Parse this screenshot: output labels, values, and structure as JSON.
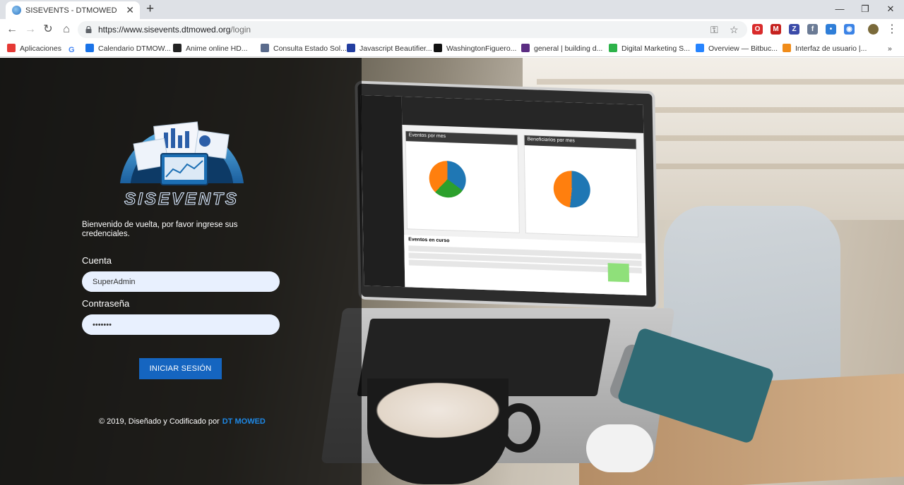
{
  "browser": {
    "tab": {
      "title": "SISEVENTS - DTMOWED",
      "close_glyph": "✕",
      "favicon": "globe-icon"
    },
    "new_tab_glyph": "+",
    "window_controls": {
      "minimize": "—",
      "restore": "❐",
      "close": "✕"
    },
    "nav": {
      "back": "←",
      "forward": "→",
      "reload": "↻",
      "home": "⌂"
    },
    "url": {
      "host": "https://www.sisevents.dtmowed.org",
      "path": "/login"
    },
    "omnibox_icons": {
      "key": "⚿",
      "star": "☆"
    },
    "extensions": [
      {
        "name": "opera-ext-icon",
        "glyph": "O",
        "color": "#d92b2b"
      },
      {
        "name": "gmail-ext-icon",
        "glyph": "M",
        "color": "#c5221f"
      },
      {
        "name": "z-ext-icon",
        "glyph": "Z",
        "color": "#3b4ba8"
      },
      {
        "name": "facebook-ext-icon",
        "glyph": "f",
        "color": "#6b7b95"
      },
      {
        "name": "dots-ext-icon",
        "glyph": "•",
        "color": "#2f7ed8"
      },
      {
        "name": "chat-ext-icon",
        "glyph": "◉",
        "color": "#3b83e6"
      }
    ],
    "menu_glyph": "⋮",
    "bookmarks": [
      {
        "label": "Aplicaciones",
        "color": "#e53935"
      },
      {
        "label": "",
        "glyph": "G",
        "color": "#4285f4"
      },
      {
        "label": "Calendario DTMOW...",
        "color": "#1a73e8"
      },
      {
        "label": "Anime online HD...",
        "color": "#222222"
      },
      {
        "label": "Consulta Estado Sol...",
        "color": "#5a6b8c"
      },
      {
        "label": "Javascript Beautifier...",
        "color": "#233ea0"
      },
      {
        "label": "WashingtonFiguero...",
        "color": "#111111"
      },
      {
        "label": "general | building d...",
        "color": "#5b2d82"
      },
      {
        "label": "Digital Marketing S...",
        "color": "#2db34a"
      },
      {
        "label": "Overview — Bitbuc...",
        "color": "#2684ff"
      },
      {
        "label": "Interfaz de usuario |...",
        "color": "#f08c1a"
      }
    ],
    "bookmarks_overflow": "»"
  },
  "login": {
    "logo_text": "SISEVENTS",
    "welcome": "Bienvenido de vuelta, por favor ingrese sus credenciales.",
    "account_label": "Cuenta",
    "account_value": "SuperAdmin",
    "password_label": "Contraseña",
    "password_value": "•••••••",
    "submit_label": "INICIAR SESIÓN",
    "footer_text": "© 2019, Diseñado y Codificado por",
    "footer_link": "DT MOWED"
  },
  "background_screen": {
    "card1_title": "Eventos por mes",
    "card2_title": "Beneficiarios por mes",
    "events_title": "Eventos en curso",
    "colors": {
      "blue": "#1f77b4",
      "orange": "#ff7f0e",
      "green": "#2ca02c"
    }
  }
}
